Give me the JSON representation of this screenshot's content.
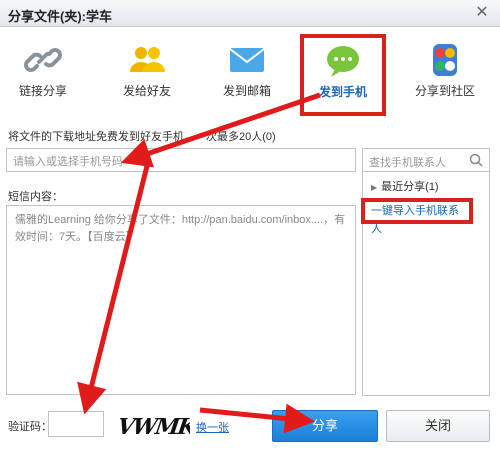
{
  "window": {
    "title": "分享文件(夹):学车",
    "close_glyph": "✕"
  },
  "tabs": [
    {
      "label": "链接分享",
      "icon": "link-icon"
    },
    {
      "label": "发给好友",
      "icon": "friends-icon"
    },
    {
      "label": "发到邮箱",
      "icon": "mail-icon"
    },
    {
      "label": "发到手机",
      "icon": "sms-icon",
      "active": true
    },
    {
      "label": "分享到社区",
      "icon": "community-icon"
    }
  ],
  "form": {
    "description": "将文件的下载地址免费发到好友手机，一次最多20人(0)",
    "phone_placeholder": "请输入或选择手机号码",
    "sms_label": "短信内容：",
    "sms_content": "儒雅的Learning 给你分享了文件：http://pan.baidu.com/inbox....，有效时间：7天。【百度云】"
  },
  "contacts": {
    "search_placeholder": "查找手机联系人",
    "recent_label": "最近分享(1)",
    "import_label": "一键导入手机联系人"
  },
  "captcha": {
    "label": "验证码：",
    "code": "VWMK",
    "refresh_label": "换一张"
  },
  "buttons": {
    "share": "分享",
    "close": "关闭"
  },
  "colors": {
    "accent": "#1c7fd8",
    "highlight": "#d9221c",
    "link": "#1a66b8"
  }
}
